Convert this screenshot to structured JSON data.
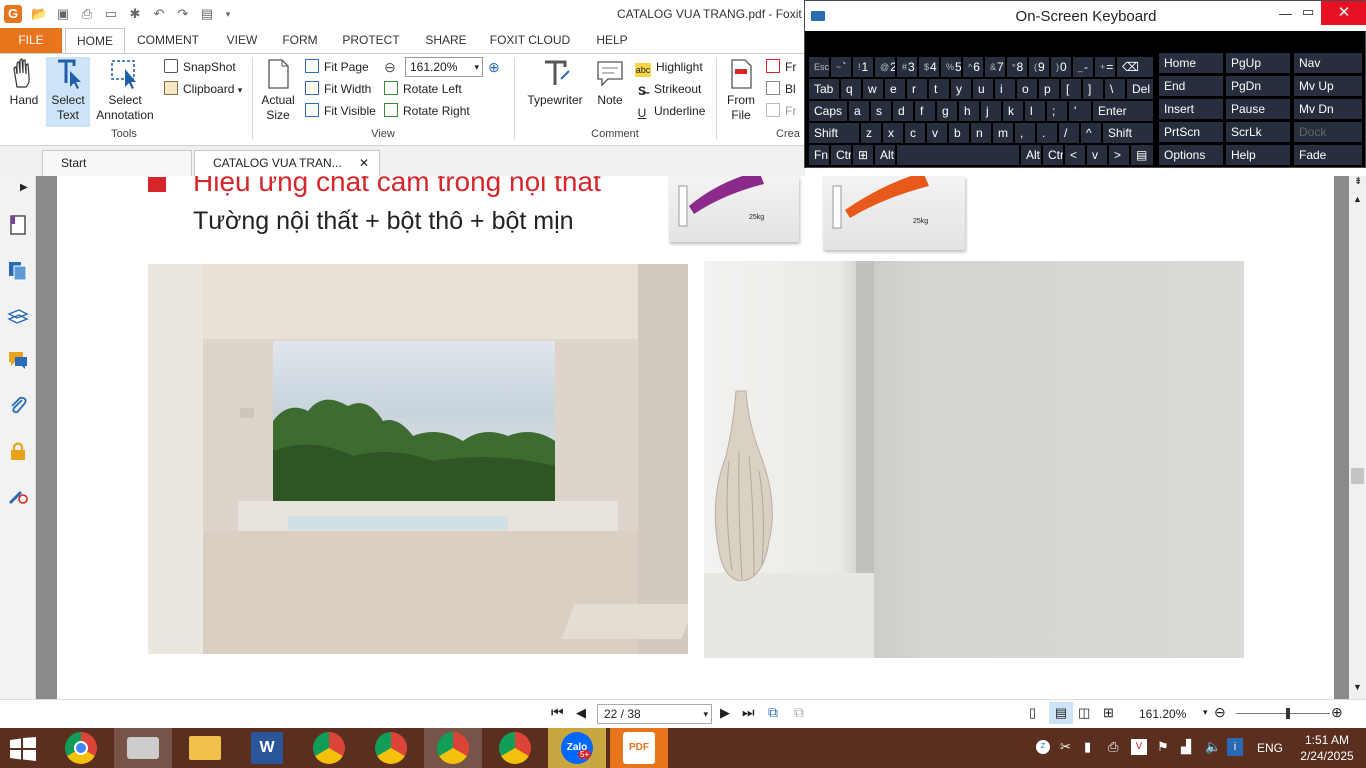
{
  "window": {
    "title": "CATALOG VUA TRANG.pdf - Foxit",
    "logo": "G"
  },
  "ribbon_tabs": [
    "FILE",
    "HOME",
    "COMMENT",
    "VIEW",
    "FORM",
    "PROTECT",
    "SHARE",
    "FOXIT CLOUD",
    "HELP"
  ],
  "tools": {
    "hand": "Hand",
    "select_text_1": "Select",
    "select_text_2": "Text",
    "select_annot_1": "Select",
    "select_annot_2": "Annotation",
    "snapshot": "SnapShot",
    "clipboard": "Clipboard",
    "group": "Tools"
  },
  "view": {
    "actual_1": "Actual",
    "actual_2": "Size",
    "fit_page": "Fit Page",
    "fit_width": "Fit Width",
    "fit_visible": "Fit Visible",
    "zoom": "161.20%",
    "rotate_left": "Rotate Left",
    "rotate_right": "Rotate Right",
    "group": "View"
  },
  "comment": {
    "typewriter": "Typewriter",
    "note": "Note",
    "highlight": "Highlight",
    "strikeout": "Strikeout",
    "underline": "Underline",
    "group": "Comment",
    "highlight_tag": "abc"
  },
  "create": {
    "from_1": "From",
    "from_2": "File",
    "fr1": "Fr",
    "bl": "Bl",
    "fr2": "Fr",
    "group": "Crea"
  },
  "doc_tabs": {
    "start": "Start",
    "file": "CATALOG VUA TRAN...",
    "close": "✕"
  },
  "pdf": {
    "heading": "Hiệu ứng chất cảm trong nội thất",
    "subheading": "Tường nội thất + bột thô + bột mịn",
    "bag_weight": "25kg"
  },
  "status": {
    "page": "22 / 38",
    "zoom": "161.20%"
  },
  "osk": {
    "title": "On-Screen Keyboard",
    "row1": [
      [
        "Esc",
        ""
      ],
      [
        "~",
        "`"
      ],
      [
        "!",
        "1"
      ],
      [
        "@",
        "2"
      ],
      [
        "#",
        "3"
      ],
      [
        "$",
        "4"
      ],
      [
        "%",
        "5"
      ],
      [
        "^",
        "6"
      ],
      [
        "&",
        "7"
      ],
      [
        "*",
        "8"
      ],
      [
        "(",
        "9"
      ],
      [
        ")",
        "0"
      ],
      [
        "_",
        "-"
      ],
      [
        "+",
        "="
      ],
      [
        "",
        "⌫"
      ]
    ],
    "row2": [
      "Tab",
      "q",
      "w",
      "e",
      "r",
      "t",
      "y",
      "u",
      "i",
      "o",
      "p",
      "[",
      "]",
      "\\",
      "Del"
    ],
    "row3": [
      "Caps",
      "a",
      "s",
      "d",
      "f",
      "g",
      "h",
      "j",
      "k",
      "l",
      ";",
      "'",
      "Enter"
    ],
    "row4": [
      "Shift",
      "z",
      "x",
      "c",
      "v",
      "b",
      "n",
      "m",
      ",",
      ".",
      "/",
      "^",
      "Shift"
    ],
    "row5": [
      "Fn",
      "Ctrl",
      "⊞",
      "Alt",
      "",
      "Alt",
      "Ctrl",
      "<",
      "v",
      ">",
      "▤"
    ],
    "nav_keys": [
      [
        "Home",
        "PgUp",
        "Nav"
      ],
      [
        "End",
        "PgDn",
        "Mv Up"
      ],
      [
        "Insert",
        "Pause",
        "Mv Dn"
      ],
      [
        "PrtScn",
        "ScrLk",
        "Dock"
      ],
      [
        "Options",
        "Help",
        "Fade"
      ]
    ]
  },
  "tray": {
    "lang": "ENG",
    "time": "1:51 AM",
    "date": "2/24/2025",
    "zalo_badge": "5+",
    "zalo_label": "Zalo",
    "pdf_label": "PDF"
  },
  "colors": {
    "accent": "#e8741b",
    "heading_red": "#d7262b",
    "taskbar": "#5a2f1f",
    "osk_key": "#272f3e"
  }
}
